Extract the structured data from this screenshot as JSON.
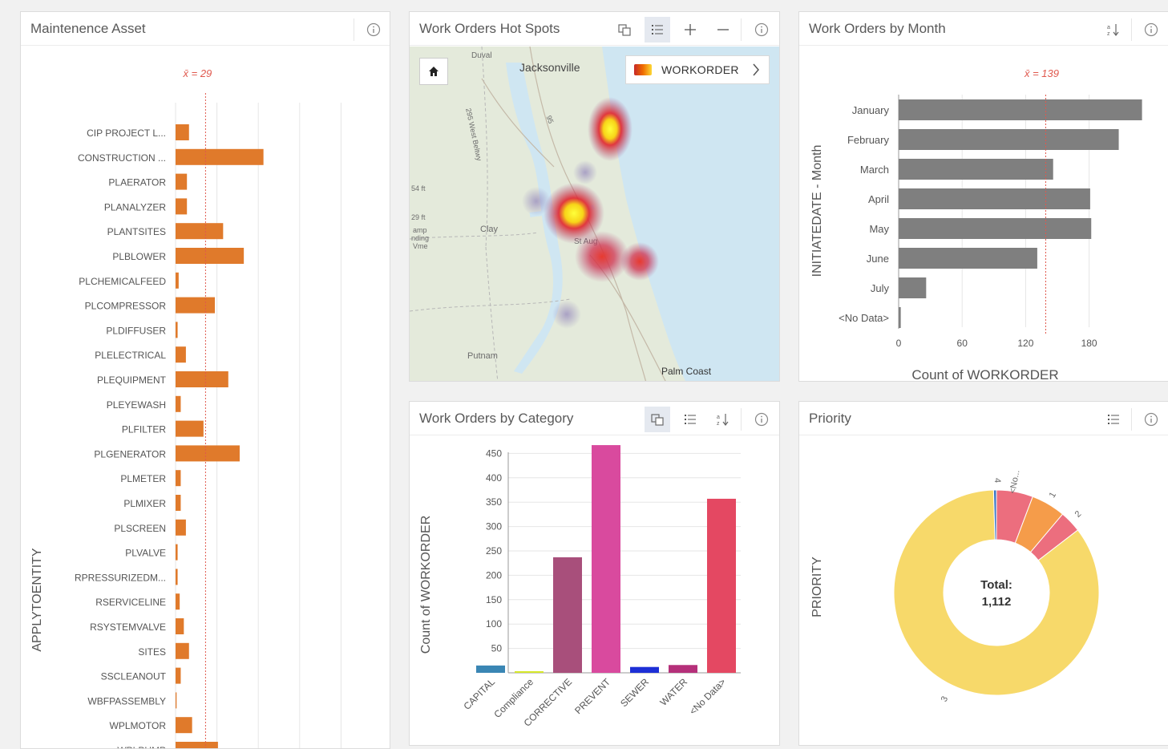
{
  "panels": {
    "asset": {
      "title": "Maintenence Asset",
      "avg_label": "x̄ = 29",
      "y_label": "APPLYTOENTITY"
    },
    "map": {
      "title": "Work Orders Hot Spots",
      "legend_label": "WORKORDER",
      "places": {
        "jacksonville": "Jacksonville",
        "duval": "Duval",
        "clay": "Clay",
        "putnam": "Putnam",
        "palm_coast": "Palm Coast",
        "beltway": "295 West Beltwy",
        "hwy95": "95",
        "elev1": "54 ft",
        "elev2": "29 ft",
        "camp": "amp",
        "landing": "nding",
        "blanding": "Vme",
        "staug": "St Aug"
      }
    },
    "month": {
      "title": "Work Orders by Month",
      "avg_label": "x̄ = 139",
      "y_label": "INITIATEDATE - Month",
      "x_label": "Count of WORKORDER"
    },
    "category": {
      "title": "Work Orders by Category",
      "y_label": "Count of WORKORDER"
    },
    "priority": {
      "title": "Priority",
      "y_label": "PRIORITY",
      "total_label": "Total:",
      "total_value": "1,112"
    }
  },
  "colors": {
    "orange": "#e07a2b",
    "gray": "#7f7f7f",
    "avg_line": "#e0584d",
    "accent": "#1d6fd6"
  },
  "chart_data": [
    {
      "type": "bar",
      "orientation": "horizontal",
      "title": "Maintenence Asset",
      "ylabel": "APPLYTOENTITY",
      "mean": 29,
      "xlim": [
        0,
        200
      ],
      "grid": "vertical",
      "categories": [
        "CIP PROJECT L...",
        "CONSTRUCTION ...",
        "PLAERATOR",
        "PLANALYZER",
        "PLANTSITES",
        "PLBLOWER",
        "PLCHEMICALFEED",
        "PLCOMPRESSOR",
        "PLDIFFUSER",
        "PLELECTRICAL",
        "PLEQUIPMENT",
        "PLEYEWASH",
        "PLFILTER",
        "PLGENERATOR",
        "PLMETER",
        "PLMIXER",
        "PLSCREEN",
        "PLVALVE",
        "RPRESSURIZEDM...",
        "RSERVICELINE",
        "RSYSTEMVALVE",
        "SITES",
        "SSCLEANOUT",
        "WBFPASSEMBLY",
        "WPLMOTOR",
        "WPLPUMP"
      ],
      "values": [
        13,
        85,
        11,
        11,
        46,
        66,
        3,
        38,
        2,
        10,
        51,
        5,
        27,
        62,
        5,
        5,
        10,
        2,
        2,
        4,
        8,
        13,
        5,
        1,
        16,
        41
      ],
      "color": "#e07a2b"
    },
    {
      "type": "bar",
      "orientation": "horizontal",
      "title": "Work Orders by Month",
      "xlabel": "Count of WORKORDER",
      "ylabel": "INITIATEDATE - Month",
      "mean": 139,
      "xlim": [
        0,
        230
      ],
      "xticks": [
        0,
        60,
        120,
        180
      ],
      "grid": "vertical",
      "categories": [
        "January",
        "February",
        "March",
        "April",
        "May",
        "June",
        "July",
        "<No Data>"
      ],
      "values": [
        230,
        208,
        146,
        181,
        182,
        131,
        26,
        2
      ],
      "color": "#7f7f7f"
    },
    {
      "type": "bar",
      "title": "Work Orders by Category",
      "ylabel": "Count of WORKORDER",
      "ylim": [
        0,
        480
      ],
      "yticks": [
        50,
        100,
        150,
        200,
        250,
        300,
        350,
        400,
        450
      ],
      "grid": "horizontal",
      "categories": [
        "CAPITAL",
        "Compliance",
        "CORRECTIVE",
        "PREVENT",
        "SEWER",
        "WATER",
        "<No Data>"
      ],
      "values": [
        15,
        3,
        237,
        467,
        12,
        16,
        357
      ],
      "colors": [
        "#3a86b4",
        "#d6e82a",
        "#a84f7b",
        "#d94a9e",
        "#1d2fd6",
        "#b5307a",
        "#e44862"
      ]
    },
    {
      "type": "pie",
      "donut": true,
      "title": "Priority",
      "ylabel": "PRIORITY",
      "total": 1112,
      "categories": [
        "<No...",
        "1",
        "2",
        "3",
        "4"
      ],
      "values": [
        64,
        60,
        38,
        945,
        5
      ],
      "colors": [
        "#ec6e7e",
        "#f59c4a",
        "#ec6e7e",
        "#f7d96a",
        "#3a76c4"
      ]
    }
  ]
}
